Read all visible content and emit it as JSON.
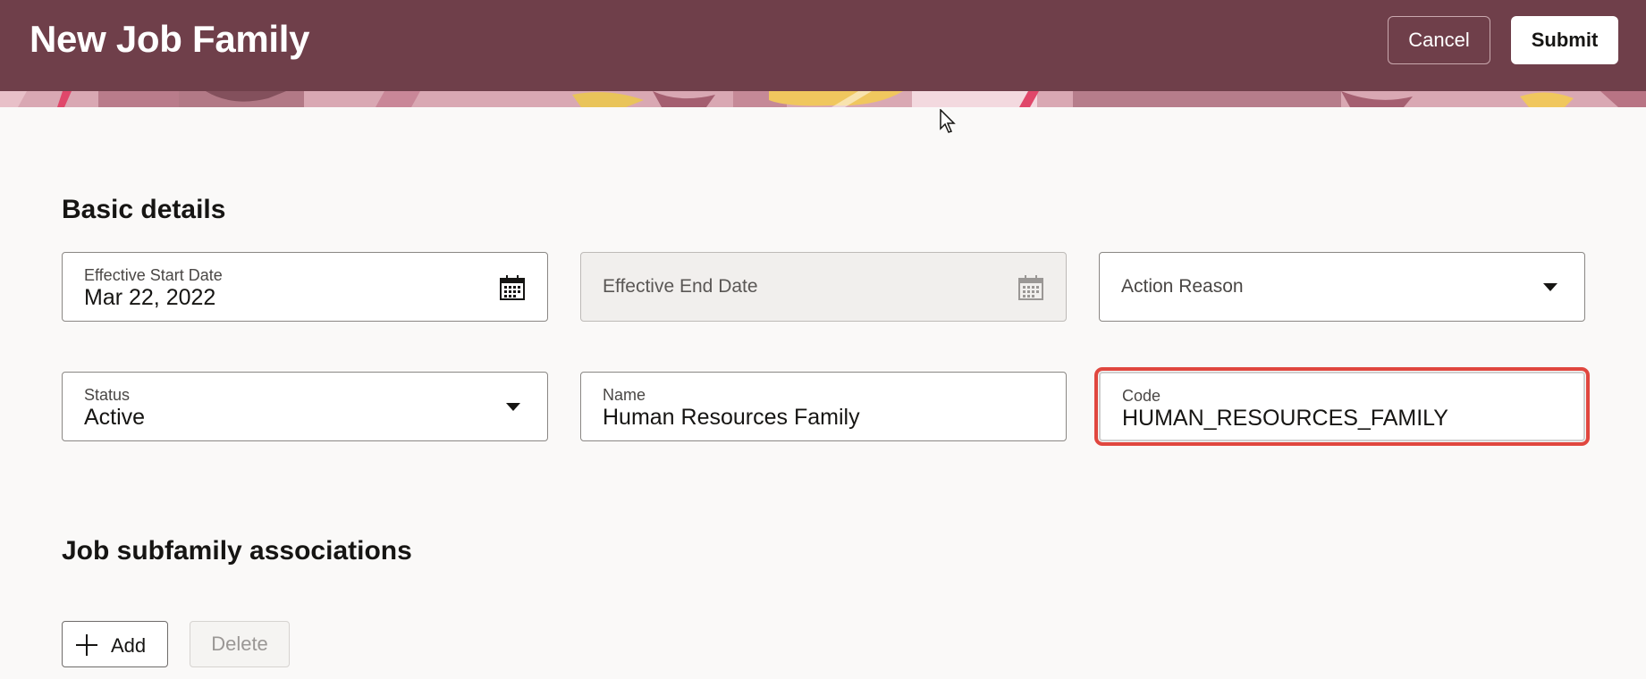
{
  "header": {
    "title": "New Job Family",
    "cancel_label": "Cancel",
    "submit_label": "Submit"
  },
  "basic_details": {
    "title": "Basic details",
    "effective_start_date": {
      "label": "Effective Start Date",
      "value": "Mar 22, 2022"
    },
    "effective_end_date": {
      "placeholder": "Effective End Date"
    },
    "action_reason": {
      "placeholder": "Action Reason"
    },
    "status": {
      "label": "Status",
      "value": "Active"
    },
    "name": {
      "label": "Name",
      "value": "Human Resources Family"
    },
    "code": {
      "label": "Code",
      "value": "HUMAN_RESOURCES_FAMILY"
    }
  },
  "subfamily": {
    "title": "Job subfamily associations",
    "add_label": "Add",
    "delete_label": "Delete"
  },
  "icons": {
    "calendar": "calendar-icon",
    "dropdown": "chevron-down-icon",
    "add": "plus-icon",
    "cursor": "mouse-pointer-icon"
  },
  "colors": {
    "header_bg": "#6f3f4a",
    "highlight": "#e0473f",
    "page_bg": "#faf9f8"
  }
}
